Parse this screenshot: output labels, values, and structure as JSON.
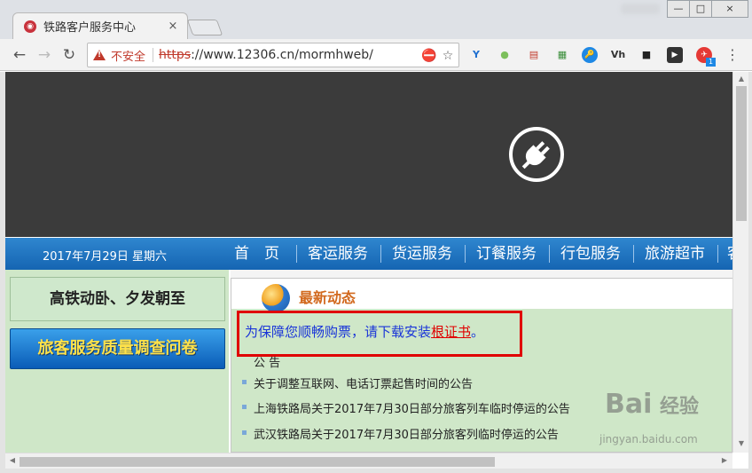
{
  "browser": {
    "tab_title": "铁路客户服务中心",
    "tab_close": "×",
    "security_label": "不安全",
    "url_scheme": "https",
    "url_rest": "://www.12306.cn/mormhweb/",
    "window_controls": {
      "minimize": "—",
      "maximize": "□",
      "close": "×"
    },
    "extensions": [
      "Y",
      "●",
      "▤",
      "▦",
      "🔑",
      "Vh",
      "■",
      "▶",
      "✈"
    ],
    "extension_badge": "1"
  },
  "page": {
    "date": "2017年7月29日 星期六",
    "nav_items": [
      "首　页",
      "客运服务",
      "货运服务",
      "订餐服务",
      "行包服务",
      "旅游超市",
      "客"
    ],
    "slogan": "高铁动卧、夕发朝至",
    "survey_button": "旅客服务质量调查问卷",
    "news_title": "最新动态",
    "banner_text_before": "为保障您顺畅购票，请下载安装",
    "banner_link": "根证书",
    "banner_text_after": "。",
    "news_items": [
      "公  告",
      "关于调整互联网、电话订票起售时间的公告",
      "上海铁路局关于2017年7月30日部分旅客列车临时停运的公告",
      "武汉铁路局关于2017年7月30日部分旅客列临时停运的公告"
    ]
  },
  "watermark": {
    "brand": "经验",
    "sub": "jingyan.baidu.com"
  }
}
